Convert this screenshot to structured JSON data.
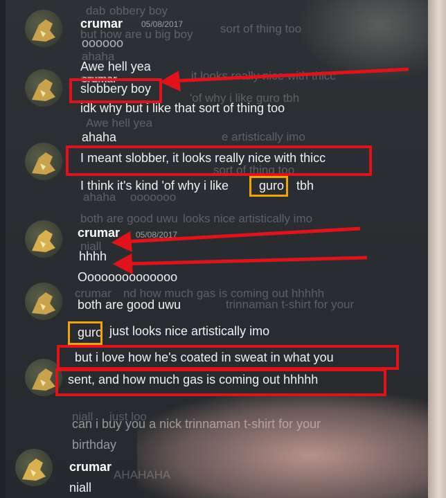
{
  "ghost": [
    "dab",
    "obbery boy",
    "sort of thing too",
    "but how are u big boy",
    "ahaha",
    "crumar",
    "it looks really nice with thicc",
    "'of why i like guro tbh",
    "Awe hell yea",
    "e artistically imo",
    "sort of thing too",
    "ahaha",
    "ooooooo",
    "both are good uwu",
    "looks nice artistically imo",
    "niall",
    "nd how much gas is coming out hhhhh",
    "trinnaman t-shirt for your",
    "crumar",
    "AHAHAHA",
    "niall",
    "just loo"
  ],
  "messages": [
    {
      "text": "crumar",
      "kind": "user"
    },
    {
      "text": "05/08/2017",
      "kind": "ts"
    },
    {
      "text": "oooooo",
      "kind": "txt"
    },
    {
      "text": "Awe hell yea",
      "kind": "txt"
    },
    {
      "text": "crumar",
      "kind": "user-faded"
    },
    {
      "text": "slobbery boy",
      "kind": "txt"
    },
    {
      "text": "idk why but i like that sort of thing too",
      "kind": "txt"
    },
    {
      "text": "ahaha",
      "kind": "txt"
    },
    {
      "text": "I meant slobber, it looks really nice with thicc",
      "kind": "txt"
    },
    {
      "text": "I think it's kind 'of why i like",
      "kind": "txt"
    },
    {
      "text": "guro",
      "kind": "txt"
    },
    {
      "text": "tbh",
      "kind": "txt"
    },
    {
      "text": "crumar",
      "kind": "user"
    },
    {
      "text": "05/08/2017",
      "kind": "ts"
    },
    {
      "text": "hhhh",
      "kind": "txt"
    },
    {
      "text": "Oooooooooooooo",
      "kind": "txt"
    },
    {
      "text": "both are good uwu",
      "kind": "txt"
    },
    {
      "text": "guro",
      "kind": "txt"
    },
    {
      "text": "just looks nice artistically imo",
      "kind": "txt"
    },
    {
      "text": "but i love how he's coated in sweat in what you",
      "kind": "txt"
    },
    {
      "text": "sent, and how much gas is coming out hhhhh",
      "kind": "txt"
    },
    {
      "text": "can i buy you a nick trinnaman t-shirt for your",
      "kind": "txt"
    },
    {
      "text": "birthday",
      "kind": "txt"
    },
    {
      "text": "crumar",
      "kind": "user"
    },
    {
      "text": "niall",
      "kind": "txt"
    }
  ],
  "colors": {
    "highlight_red": "#e0121a",
    "highlight_orange": "#f0a500"
  }
}
